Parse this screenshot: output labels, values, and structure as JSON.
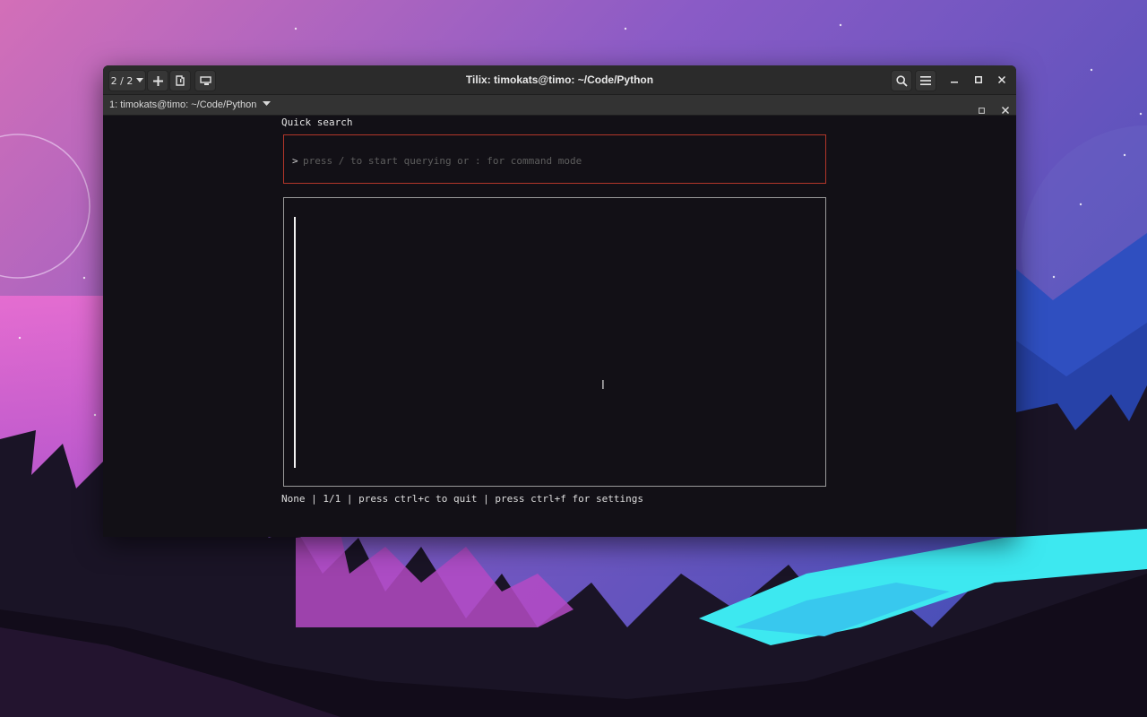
{
  "window": {
    "title": "Tilix: timokats@timo: ~/Code/Python",
    "session_switcher": "2 / 2"
  },
  "tab": {
    "label": "1: timokats@timo: ~/Code/Python"
  },
  "terminal": {
    "heading": "Quick search",
    "prompt": ">",
    "placeholder": "press / to start querying or : for command mode",
    "status": "None | 1/1 | press ctrl+c to quit | press ctrl+f for settings"
  },
  "colors": {
    "query_border": "#b2362a",
    "results_border": "#9a9a9a",
    "titlebar": "#2b2b2b"
  },
  "icons": [
    "chevron-down-icon",
    "plus-icon",
    "new-session-icon",
    "sync-input-icon",
    "search-icon",
    "hamburger-menu-icon",
    "minimize-icon",
    "maximize-icon",
    "close-icon",
    "text-cursor-icon"
  ]
}
